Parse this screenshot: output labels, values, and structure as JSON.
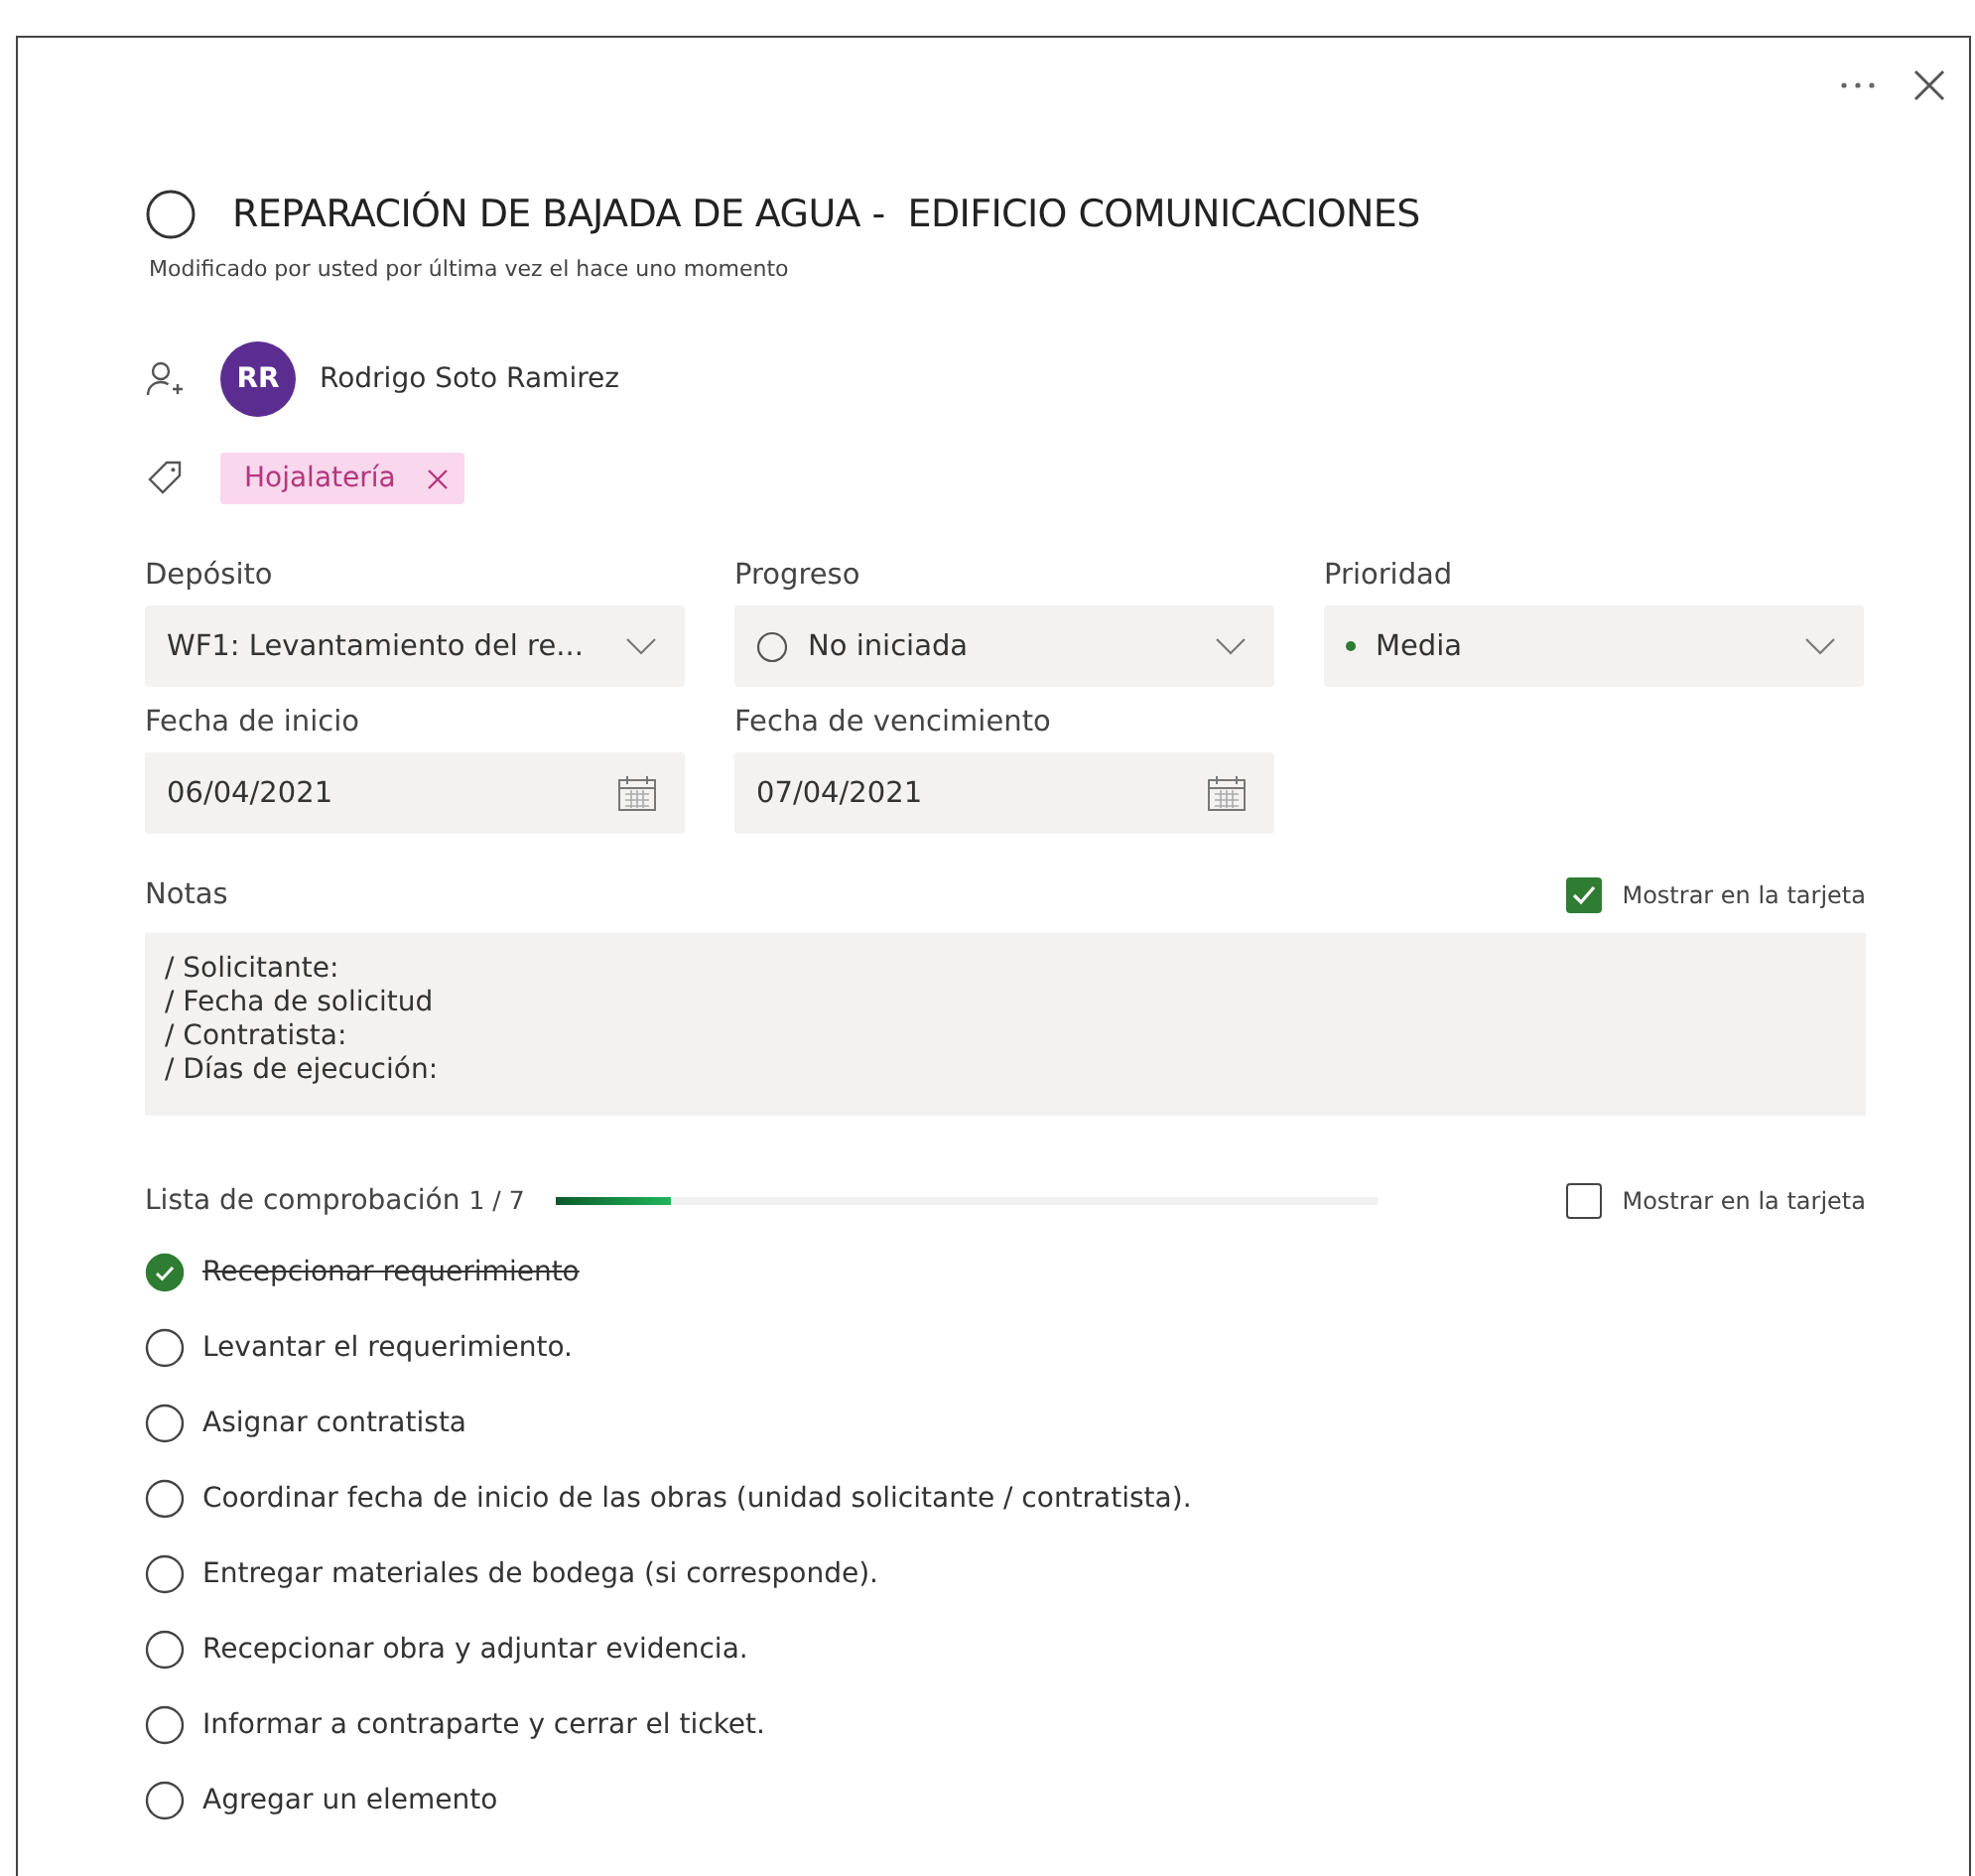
{
  "task": {
    "title": "REPARACIÓN DE BAJADA DE AGUA -  EDIFICIO COMUNICACIONES",
    "completed": false,
    "modified": "Modificado por usted por última vez el hace uno momento"
  },
  "assignee": {
    "initials": "RR",
    "name": "Rodrigo Soto Ramirez",
    "color": "#5c2d91"
  },
  "labels": [
    {
      "text": "Hojalatería",
      "color": "#f9d7ec"
    }
  ],
  "fields": [
    {
      "label": "Depósito",
      "kind": "dropdown",
      "value": "WF1: Levantamiento del re..."
    },
    {
      "label": "Progreso",
      "kind": "progress",
      "value": "No iniciada"
    },
    {
      "label": "Prioridad",
      "kind": "priority",
      "value": "Media",
      "color": "#2f7d32"
    },
    {
      "label": "Fecha de inicio",
      "kind": "date",
      "value": "06/04/2021"
    },
    {
      "label": "Fecha de vencimiento",
      "kind": "date",
      "value": "07/04/2021"
    }
  ],
  "notes": {
    "label": "Notas",
    "show_on_card_label": "Mostrar en la tarjeta",
    "show_on_card": true,
    "lines": [
      "/ Solicitante:",
      "/ Fecha de solicitud",
      "/ Contratista:",
      "/ Días de ejecución:"
    ]
  },
  "checklist": {
    "label": "Lista de comprobación",
    "count": "1 / 7",
    "level": 0.14,
    "show_on_card_label": "Mostrar en la tarjeta",
    "show_on_card": false,
    "items": [
      {
        "kind": "task",
        "text": "Recepcionar requerimiento",
        "checked": true
      },
      {
        "kind": "task",
        "text": "Levantar el requerimiento.",
        "checked": false
      },
      {
        "kind": "task",
        "text": "Asignar contratista",
        "checked": false
      },
      {
        "kind": "task",
        "text": "Coordinar fecha de inicio de las obras (unidad solicitante / contratista).",
        "checked": false
      },
      {
        "kind": "task",
        "text": "Entregar materiales de bodega (si corresponde).",
        "checked": false
      },
      {
        "kind": "task",
        "text": "Recepcionar obra y adjuntar evidencia.",
        "checked": false
      },
      {
        "kind": "task",
        "text": "Informar a contraparte y cerrar el ticket.",
        "checked": false
      },
      {
        "kind": "add",
        "text": "Agregar un elemento"
      }
    ]
  }
}
